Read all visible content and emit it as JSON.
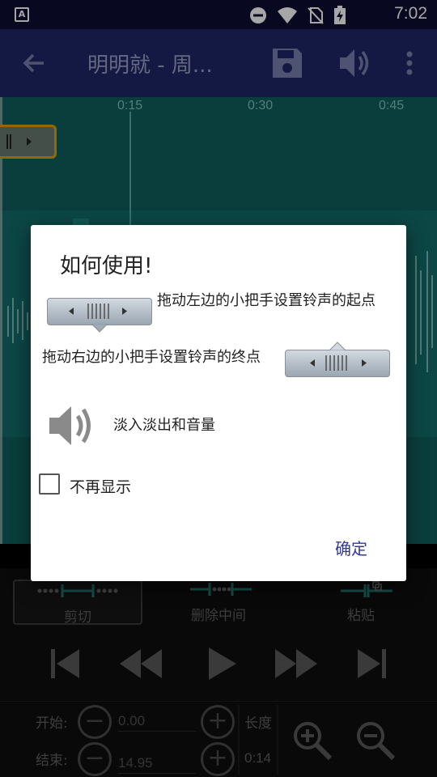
{
  "status_bar": {
    "app_indicator": "A",
    "time": "7:02",
    "icons": [
      "do-not-disturb-icon",
      "wifi-icon",
      "no-sim-icon",
      "battery-charging-icon"
    ]
  },
  "toolbar": {
    "title": "明明就 - 周...",
    "icons": [
      "back-arrow-icon",
      "save-icon",
      "volume-icon",
      "overflow-menu-icon"
    ]
  },
  "waveform": {
    "timeline_marks": [
      "0:15",
      "0:30",
      "0:45"
    ],
    "colors": {
      "background": "#10605c",
      "waveform": "#1b8a83",
      "handle_border": "#e4a000"
    }
  },
  "edit_tabs": [
    {
      "label": "剪切",
      "active": true
    },
    {
      "label": "删除中间",
      "active": false
    },
    {
      "label": "粘贴",
      "active": false
    }
  ],
  "transport": [
    "skip-to-start-icon",
    "rewind-icon",
    "play-icon",
    "fast-forward-icon",
    "skip-to-end-icon"
  ],
  "range": {
    "start_label": "开始:",
    "start_value": "0.00",
    "end_label": "结束:",
    "end_value": "14.95",
    "length_label": "长度",
    "length_value": "0:14",
    "minus_glyph": "−",
    "plus_glyph": "+"
  },
  "dialog": {
    "title": "如何使用!",
    "instruction_left_handle": "拖动左边的小把手设置铃声的起点",
    "instruction_right_handle": "拖动右边的小把手设置铃声的终点",
    "fade_text": "淡入淡出和音量",
    "dont_show_again": "不再显示",
    "dont_show_checked": false,
    "ok_button": "确定",
    "accent_color": "#2f3a9a"
  }
}
